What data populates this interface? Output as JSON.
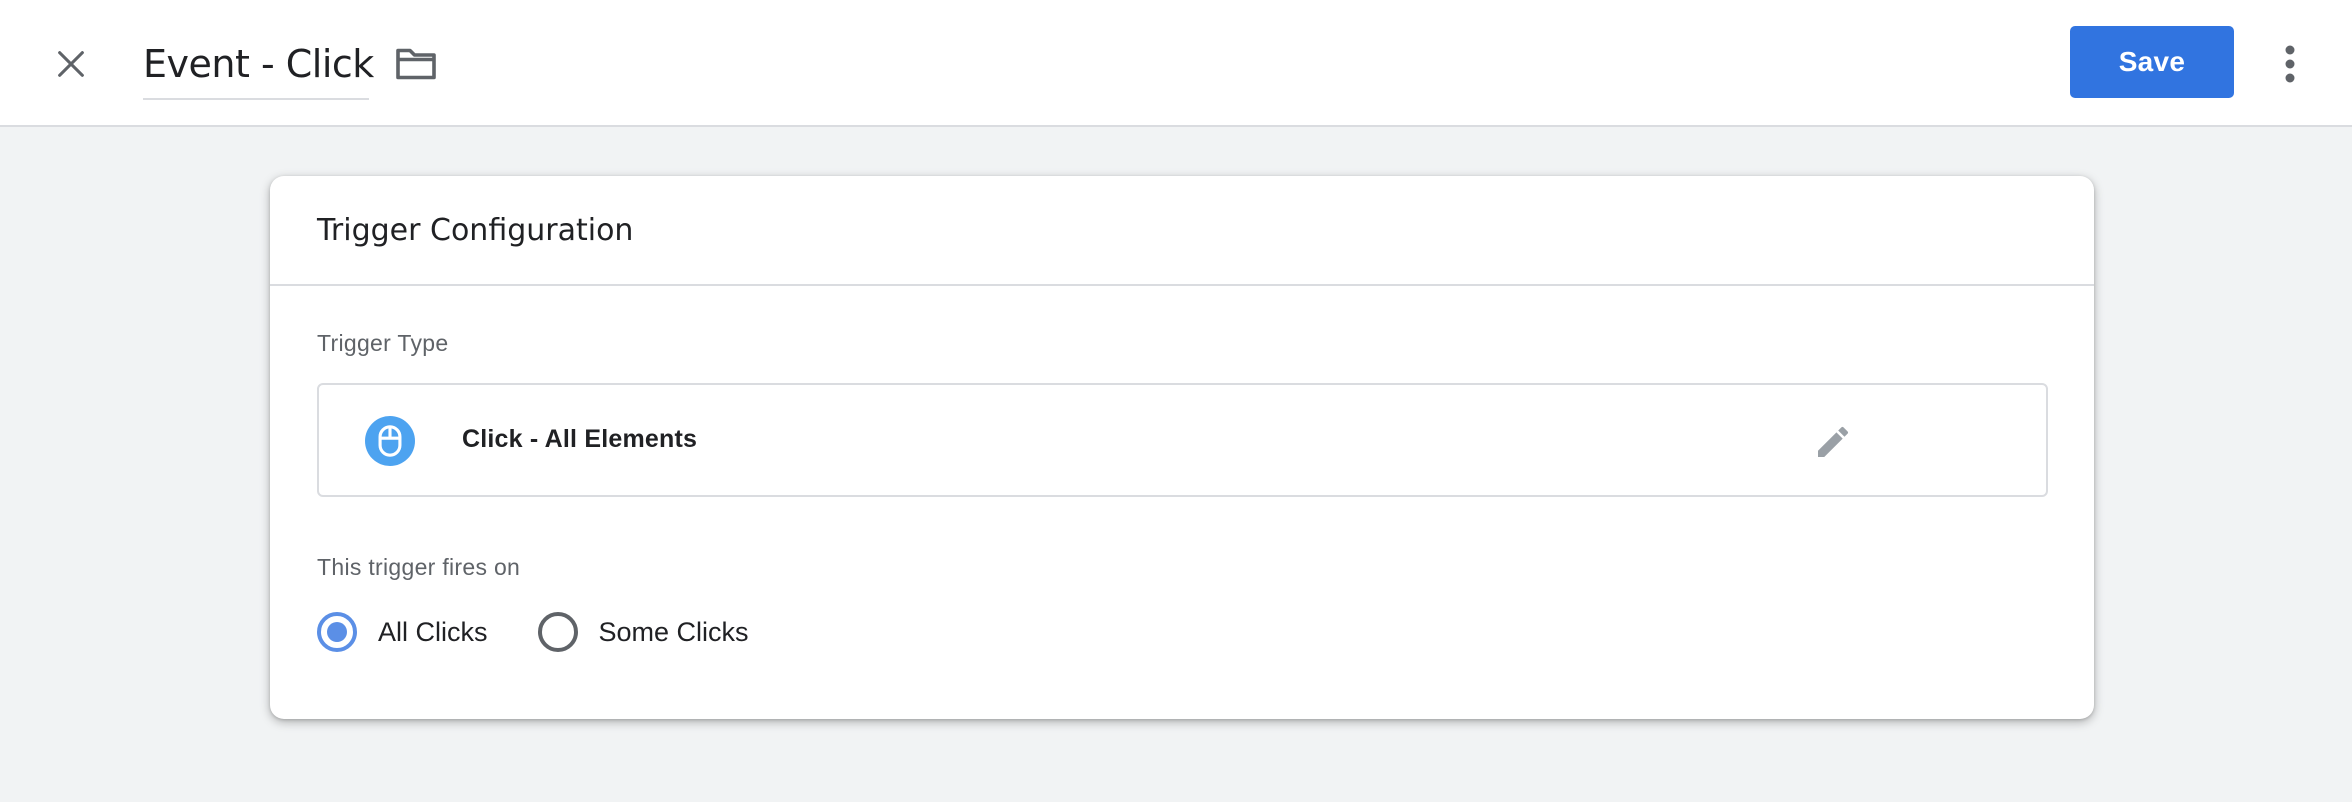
{
  "header": {
    "title": "Event - Click",
    "save_label": "Save",
    "close_icon": "close-icon",
    "folder_icon": "folder-icon",
    "more_icon": "more-vert-icon"
  },
  "card": {
    "title": "Trigger Configuration",
    "trigger_type_label": "Trigger Type",
    "trigger_type": {
      "name": "Click - All Elements",
      "icon": "mouse-icon",
      "edit_icon": "pencil-icon"
    },
    "fires_on_label": "This trigger fires on",
    "fires_on_options": [
      {
        "label": "All Clicks",
        "checked": true
      },
      {
        "label": "Some Clicks",
        "checked": false
      }
    ]
  },
  "colors": {
    "accent": "#3174e0",
    "radio_checked": "#5b8fe6",
    "trigger_icon_bg": "#4da3f0",
    "page_bg": "#f1f3f4"
  }
}
